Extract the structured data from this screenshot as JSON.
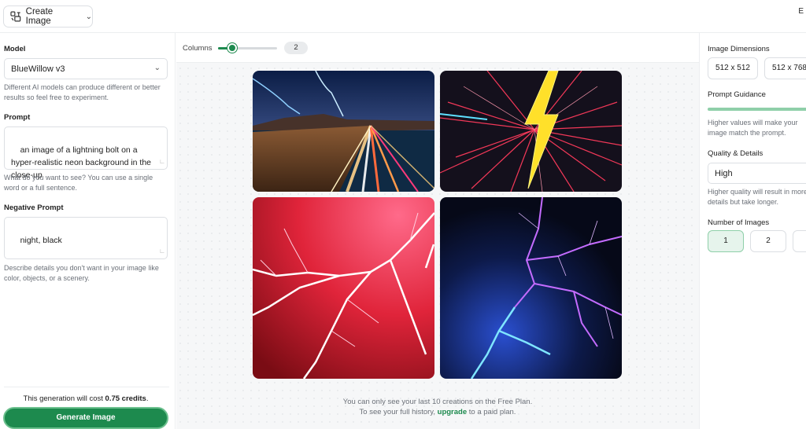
{
  "header": {
    "mode_label": "Create Image",
    "corner_char": "E"
  },
  "left": {
    "model_label": "Model",
    "model_value": "BlueWillow v3",
    "model_help": "Different AI models can produce different or better results so feel free to experiment.",
    "prompt_label": "Prompt",
    "prompt_value": "an image of a lightning bolt on a hyper-realistic neon background in the close-up",
    "prompt_help": "What do you want to see? You can use a single word or a full sentence.",
    "negative_label": "Negative Prompt",
    "negative_value": "night, black",
    "negative_help": "Describe details you don't want in your image like color, objects, or a scenery.",
    "cost_prefix": "This generation will cost ",
    "cost_value": "0.75 credits",
    "cost_suffix": ".",
    "generate_label": "Generate Image"
  },
  "center": {
    "columns_label": "Columns",
    "columns_value": "2",
    "columns_slider_fraction": 0.25,
    "footer_line1": "You can only see your last 10 creations on the Free Plan.",
    "footer_line2_prefix": "To see your full history, ",
    "footer_upgrade": "upgrade",
    "footer_line2_suffix": " to a paid plan."
  },
  "right": {
    "dimensions_label": "Image Dimensions",
    "dimensions": [
      "512 x 512",
      "512 x 768"
    ],
    "guidance_label": "Prompt Guidance",
    "guidance_help": "Higher values will make your image match the prompt.",
    "quality_label": "Quality & Details",
    "quality_value": "High",
    "quality_help": "Higher quality will result in more details but take longer.",
    "count_label": "Number of Images",
    "counts": [
      "1",
      "2",
      ""
    ],
    "selected_count": "1"
  },
  "colors": {
    "accent": "#1d8a4e",
    "accent_light": "#8fcfa9"
  }
}
